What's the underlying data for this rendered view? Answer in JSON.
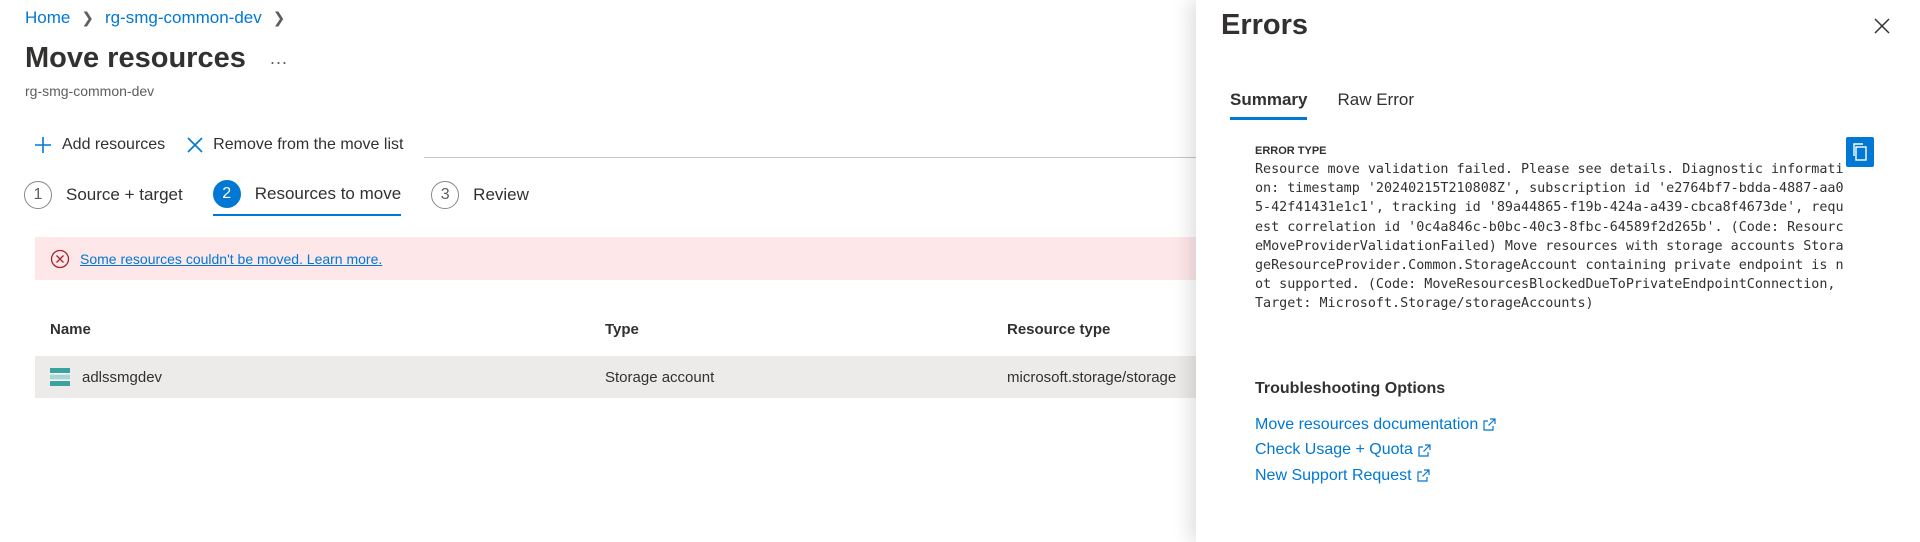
{
  "breadcrumb": {
    "home": "Home",
    "group": "rg-smg-common-dev"
  },
  "page": {
    "title": "Move resources",
    "more": "...",
    "subtitle": "rg-smg-common-dev"
  },
  "toolbar": {
    "add": "Add resources",
    "remove": "Remove from the move list"
  },
  "steps": [
    {
      "num": "1",
      "label": "Source + target"
    },
    {
      "num": "2",
      "label": "Resources to move"
    },
    {
      "num": "3",
      "label": "Review"
    }
  ],
  "alert": {
    "text": "Some resources couldn't be moved. Learn more."
  },
  "table": {
    "headers": [
      "Name",
      "Type",
      "Resource type"
    ],
    "rows": [
      {
        "name": "adlssmgdev",
        "type": "Storage account",
        "resource_type": "microsoft.storage/storage"
      }
    ]
  },
  "errors_panel": {
    "title": "Errors",
    "tabs": [
      "Summary",
      "Raw Error"
    ],
    "error_type_label": "ERROR TYPE",
    "error_text": "Resource move validation failed. Please see details. Diagnostic information: timestamp '20240215T210808Z', subscription id 'e2764bf7-bdda-4887-aa05-42f41431e1c1', tracking id '89a44865-f19b-424a-a439-cbca8f4673de', request correlation id '0c4a846c-b0bc-40c3-8fbc-64589f2d265b'. (Code: ResourceMoveProviderValidationFailed) Move resources with storage accounts StorageResourceProvider.Common.StorageAccount containing private endpoint is not supported. (Code: MoveResourcesBlockedDueToPrivateEndpointConnection, Target: Microsoft.Storage/storageAccounts)",
    "troubleshooting_title": "Troubleshooting Options",
    "links": [
      "Move resources documentation",
      "Check Usage + Quota",
      "New Support Request"
    ]
  },
  "colors": {
    "accent": "#0078d4",
    "alert_bg": "#fde7e9",
    "error_red": "#a4262c"
  }
}
